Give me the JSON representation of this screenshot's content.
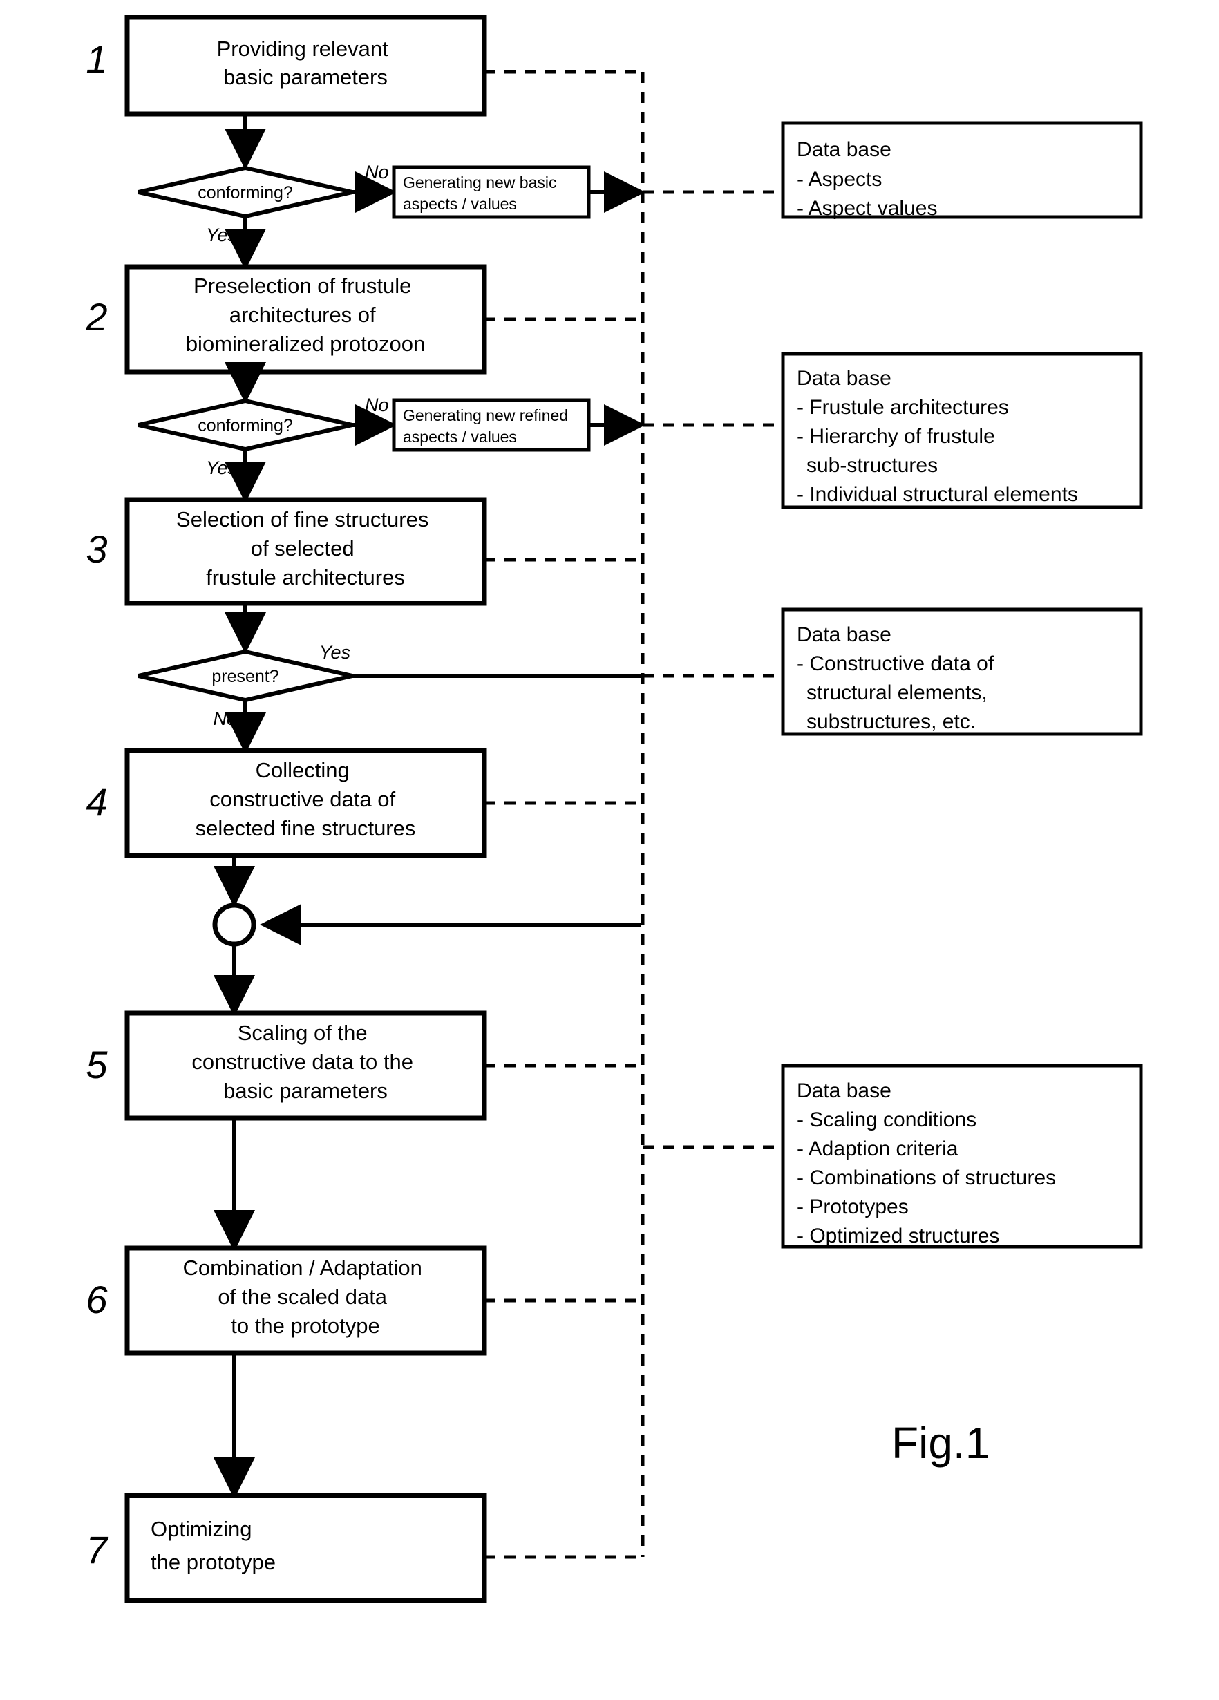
{
  "figure": {
    "label": "Fig.1",
    "caption_number": "1"
  },
  "steps": [
    {
      "number": "1",
      "lines": [
        "Providing relevant",
        "basic parameters"
      ]
    },
    {
      "number": "2",
      "lines": [
        "Preselection of frustule",
        "architectures of",
        "biomineralized protozoon"
      ]
    },
    {
      "number": "3",
      "lines": [
        "Selection of fine structures",
        "of selected",
        "frustule architectures"
      ]
    },
    {
      "number": "4",
      "lines": [
        "Collecting",
        "constructive data of",
        "selected fine structures"
      ]
    },
    {
      "number": "5",
      "lines": [
        "Scaling of the",
        "constructive data to the",
        "basic parameters"
      ]
    },
    {
      "number": "6",
      "lines": [
        "Combination / Adaptation",
        "of the scaled data",
        "to the prototype"
      ]
    },
    {
      "number": "7",
      "lines": [
        "Optimizing",
        "the prototype"
      ]
    }
  ],
  "decisions": [
    {
      "label": "conforming?",
      "yes_label": "Yes",
      "no_label": "No"
    },
    {
      "label": "conforming?",
      "yes_label": "Yes",
      "no_label": "No"
    },
    {
      "label": "present?",
      "yes_label": "Yes",
      "no_label": "No"
    }
  ],
  "generators": [
    {
      "lines": [
        "Generating new basic",
        "aspects / values"
      ]
    },
    {
      "lines": [
        "Generating new refined",
        "aspects / values"
      ]
    }
  ],
  "databases": [
    {
      "title": "Data base",
      "items": [
        "- Aspects",
        "- Aspect values"
      ]
    },
    {
      "title": "Data base",
      "items": [
        "- Frustule architectures",
        "- Hierarchy of frustule",
        "  sub-structures",
        "- Individual structural elements"
      ]
    },
    {
      "title": "Data base",
      "items": [
        "- Constructive data of",
        "  structural elements,",
        "  substructures, etc."
      ]
    },
    {
      "title": "Data base",
      "items": [
        "- Scaling conditions",
        "- Adaption criteria",
        "- Combinations of structures",
        "- Prototypes",
        "- Optimized structures"
      ]
    }
  ],
  "colors": {
    "stroke": "#000000",
    "fill": "#ffffff"
  }
}
